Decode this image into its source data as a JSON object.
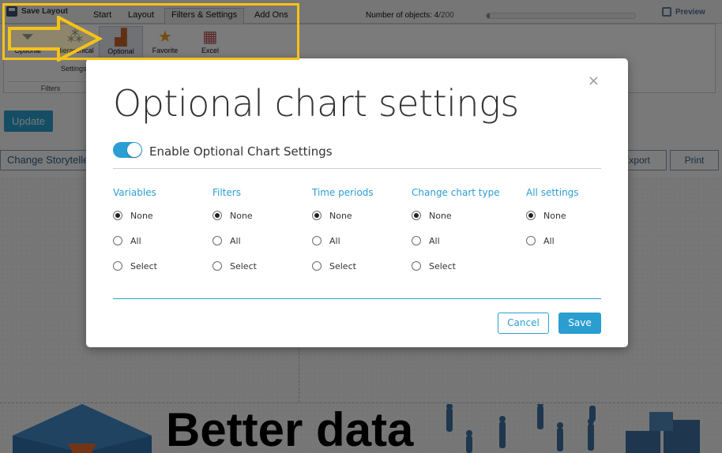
{
  "app": {
    "save_layout": "Save Layout",
    "menu_tabs": [
      "Start",
      "Layout",
      "Filters & Settings",
      "Add Ons"
    ],
    "objects_label": "Number of objects: ",
    "objects_current": "4",
    "objects_max": "/200",
    "objects_progress": 0.02,
    "preview_label": "Preview",
    "ribbon": {
      "buttons": [
        "Optional",
        "Hierarchical",
        "Optional",
        "Favorite",
        "Excel"
      ],
      "sub_label": "Settings",
      "group_label": "Filters"
    },
    "update_label": "Update",
    "storyteller_label": "Change Storyteller",
    "export_label": "Export",
    "print_label": "Print",
    "hero_text": "Better data"
  },
  "modal": {
    "close_icon": "×",
    "title": "Optional chart settings",
    "toggle_label": "Enable Optional Chart Settings",
    "toggle_on": true,
    "columns": [
      {
        "heading": "Variables",
        "options": [
          "None",
          "All",
          "Select"
        ],
        "selected": "None"
      },
      {
        "heading": "Filters",
        "options": [
          "None",
          "All",
          "Select"
        ],
        "selected": "None"
      },
      {
        "heading": "Time periods",
        "options": [
          "None",
          "All",
          "Select"
        ],
        "selected": "None"
      },
      {
        "heading": "Change chart type",
        "options": [
          "None",
          "All",
          "Select"
        ],
        "selected": "None"
      },
      {
        "heading": "All settings",
        "options": [
          "None",
          "All"
        ],
        "selected": "None"
      }
    ],
    "cancel_label": "Cancel",
    "save_label": "Save"
  },
  "colors": {
    "accent": "#2a9ed0",
    "highlight": "#f5c218",
    "overlay": "rgba(0,0,0,0.5)"
  }
}
